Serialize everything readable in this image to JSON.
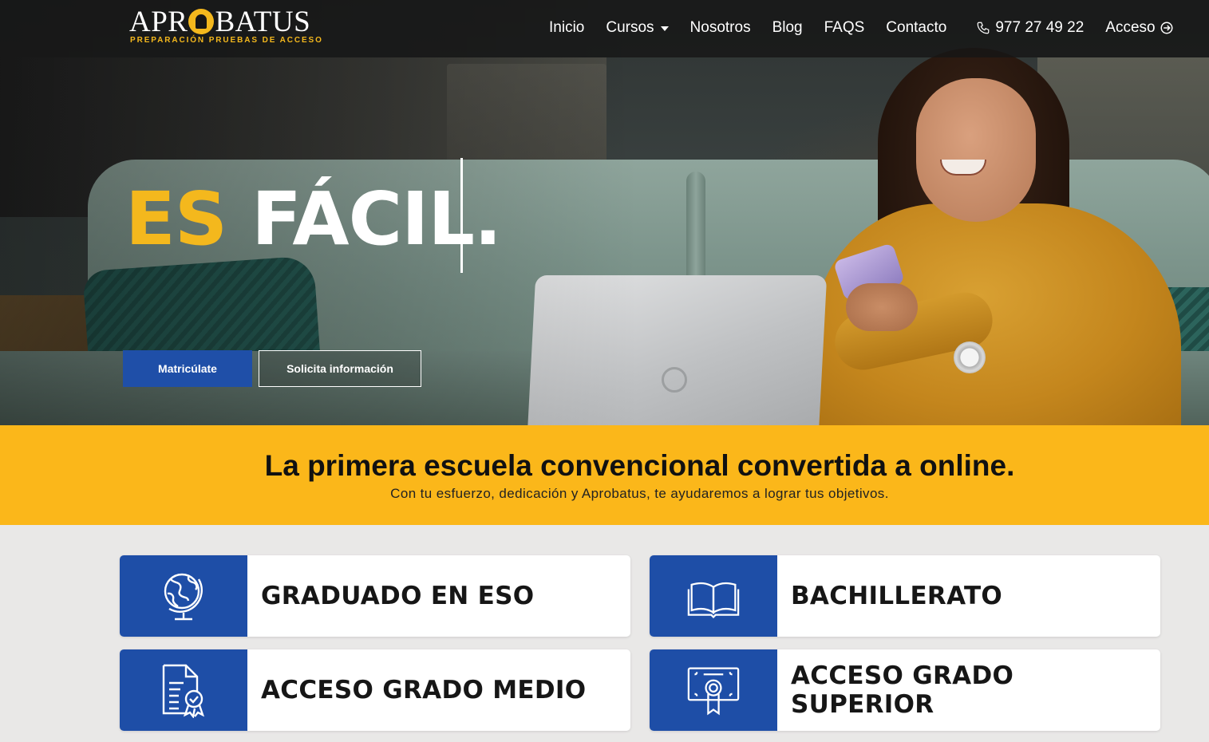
{
  "logo": {
    "name_before": "APR",
    "name_after": "BATUS",
    "tagline": "PREPARACIÓN PRUEBAS DE ACCESO"
  },
  "nav": {
    "items": [
      {
        "label": "Inicio"
      },
      {
        "label": "Cursos",
        "has_dropdown": true
      },
      {
        "label": "Nosotros"
      },
      {
        "label": "Blog"
      },
      {
        "label": "FAQS"
      },
      {
        "label": "Contacto"
      }
    ],
    "phone": "977 27 49 22",
    "login": "Acceso"
  },
  "hero": {
    "headline_accent": "ES",
    "headline_rest": "FÁCIL.",
    "primary_button": "Matricúlate",
    "secondary_button": "Solicita información"
  },
  "banner": {
    "title": "La primera escuela convencional convertida a online.",
    "subtitle": "Con tu esfuerzo, dedicación y Aprobatus, te ayudaremos a lograr tus objetivos."
  },
  "courses": [
    {
      "title": "GRADUADO EN ESO",
      "icon": "globe-icon"
    },
    {
      "title": "BACHILLERATO",
      "icon": "book-icon"
    },
    {
      "title": "ACCESO GRADO MEDIO",
      "icon": "certificate-document-icon"
    },
    {
      "title": "ACCESO GRADO SUPERIOR",
      "icon": "diploma-icon"
    }
  ],
  "colors": {
    "accent_yellow": "#fbb71a",
    "brand_blue": "#1e4ea7",
    "navbar": "#161616"
  }
}
